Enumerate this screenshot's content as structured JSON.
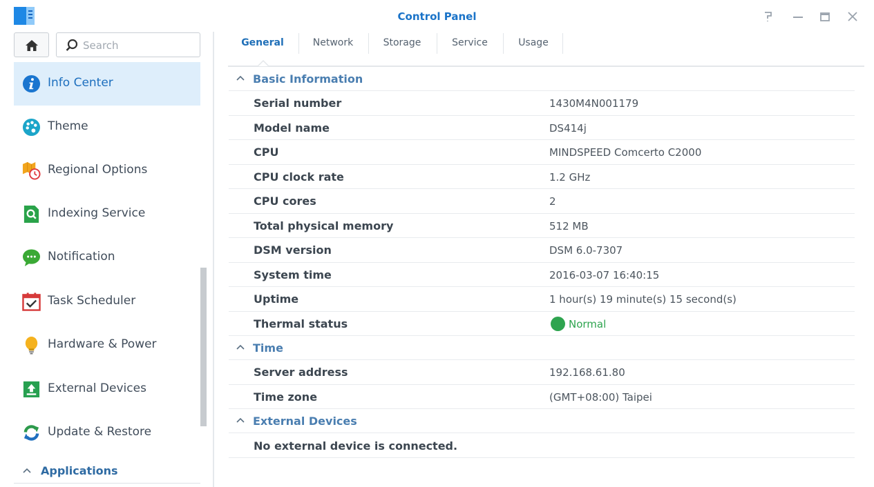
{
  "window": {
    "title": "Control Panel"
  },
  "sidebar": {
    "search_placeholder": "Search",
    "items": [
      {
        "label": "Info Center",
        "icon": "info-icon",
        "active": true
      },
      {
        "label": "Theme",
        "icon": "palette-icon",
        "active": false
      },
      {
        "label": "Regional Options",
        "icon": "map-clock-icon",
        "active": false
      },
      {
        "label": "Indexing Service",
        "icon": "magnifier-icon",
        "active": false
      },
      {
        "label": "Notification",
        "icon": "chat-bubble-icon",
        "active": false
      },
      {
        "label": "Task Scheduler",
        "icon": "calendar-check-icon",
        "active": false
      },
      {
        "label": "Hardware & Power",
        "icon": "lightbulb-icon",
        "active": false
      },
      {
        "label": "External Devices",
        "icon": "upload-icon",
        "active": false
      },
      {
        "label": "Update & Restore",
        "icon": "refresh-icon",
        "active": false
      }
    ],
    "applications_label": "Applications"
  },
  "tabs": [
    {
      "label": "General",
      "active": true
    },
    {
      "label": "Network",
      "active": false
    },
    {
      "label": "Storage",
      "active": false
    },
    {
      "label": "Service",
      "active": false
    },
    {
      "label": "Usage",
      "active": false
    }
  ],
  "sections": {
    "basic": {
      "title": "Basic Information",
      "rows": [
        {
          "label": "Serial number",
          "value": "1430M4N001179"
        },
        {
          "label": "Model name",
          "value": "DS414j"
        },
        {
          "label": "CPU",
          "value": "MINDSPEED Comcerto C2000"
        },
        {
          "label": "CPU clock rate",
          "value": "1.2 GHz"
        },
        {
          "label": "CPU cores",
          "value": "2"
        },
        {
          "label": "Total physical memory",
          "value": "512 MB"
        },
        {
          "label": "DSM version",
          "value": "DSM 6.0-7307"
        },
        {
          "label": "System time",
          "value": "2016-03-07 16:40:15"
        },
        {
          "label": "Uptime",
          "value": "1 hour(s) 19 minute(s) 15 second(s)"
        }
      ],
      "thermal": {
        "label": "Thermal status",
        "value": "Normal",
        "color": "#2ea44f"
      }
    },
    "time": {
      "title": "Time",
      "rows": [
        {
          "label": "Server address",
          "value": "192.168.61.80"
        },
        {
          "label": "Time zone",
          "value": "(GMT+08:00) Taipei"
        }
      ]
    },
    "external": {
      "title": "External Devices",
      "message": "No external device is connected."
    }
  },
  "colors": {
    "accent": "#1a73c8",
    "active_bg": "#deeefb",
    "section_title": "#4a7eb0"
  }
}
